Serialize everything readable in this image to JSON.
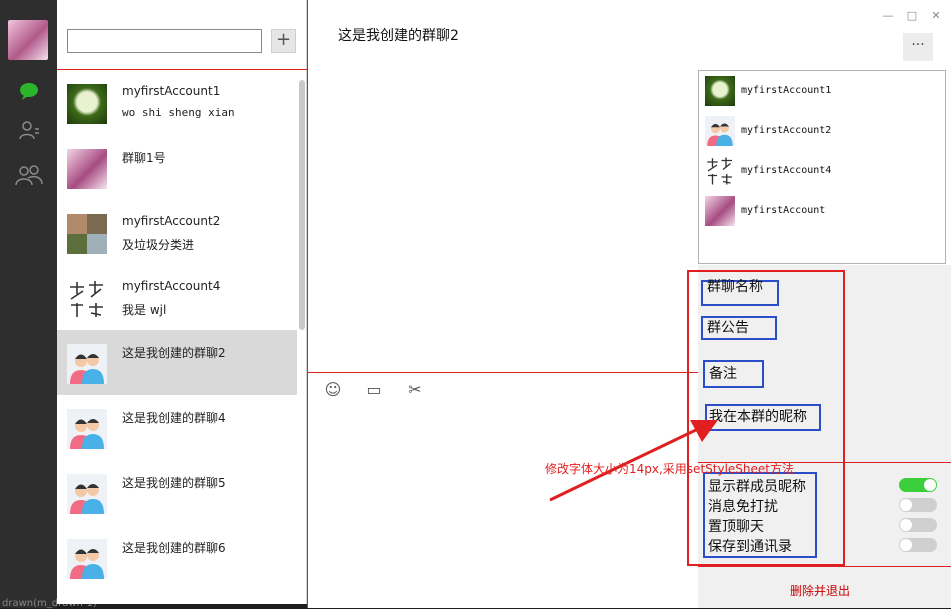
{
  "chat": {
    "title": "这是我创建的群聊2",
    "more_label": "···"
  },
  "window": {
    "min": "—",
    "max": "□",
    "close": "✕"
  },
  "toolbar": {
    "emoji": "☺",
    "folder": "▭",
    "scissors": "✂"
  },
  "search": {
    "value": "",
    "plus": "+"
  },
  "conversations": [
    {
      "name": "myfirstAccount1",
      "msg": "wo shi sheng xian"
    },
    {
      "name": "群聊1号",
      "msg": ""
    },
    {
      "name": "myfirstAccount2",
      "msg": "及垃圾分类进"
    },
    {
      "name": "myfirstAccount4",
      "msg": "我是 wjl"
    },
    {
      "name": "这是我创建的群聊2",
      "msg": ""
    },
    {
      "name": "这是我创建的群聊4",
      "msg": ""
    },
    {
      "name": "这是我创建的群聊5",
      "msg": ""
    },
    {
      "name": "这是我创建的群聊6",
      "msg": ""
    }
  ],
  "members": [
    {
      "name": "myfirstAccount1"
    },
    {
      "name": "myfirstAccount2"
    },
    {
      "name": "myfirstAccount4"
    },
    {
      "name": "myfirstAccount"
    }
  ],
  "settings": {
    "group_name": "群聊名称",
    "announcement": "群公告",
    "remark": "备注",
    "my_nickname": "我在本群的昵称",
    "show_nicknames": "显示群成员昵称",
    "mute": "消息免打扰",
    "pin": "置顶聊天",
    "save_contacts": "保存到通讯录",
    "delete_exit": "删除并退出",
    "toggles": {
      "show_nicknames": true,
      "mute": false,
      "pin": false,
      "save_contacts": false
    }
  },
  "annotation": "修改字体大小为14px,采用setStyleSheet方法",
  "bg_text": "drawn(m_drawn-1)",
  "colors": {
    "accent_green": "#3ccf3c",
    "annotation_red": "#e02020",
    "box_blue": "#2b4dc9"
  }
}
